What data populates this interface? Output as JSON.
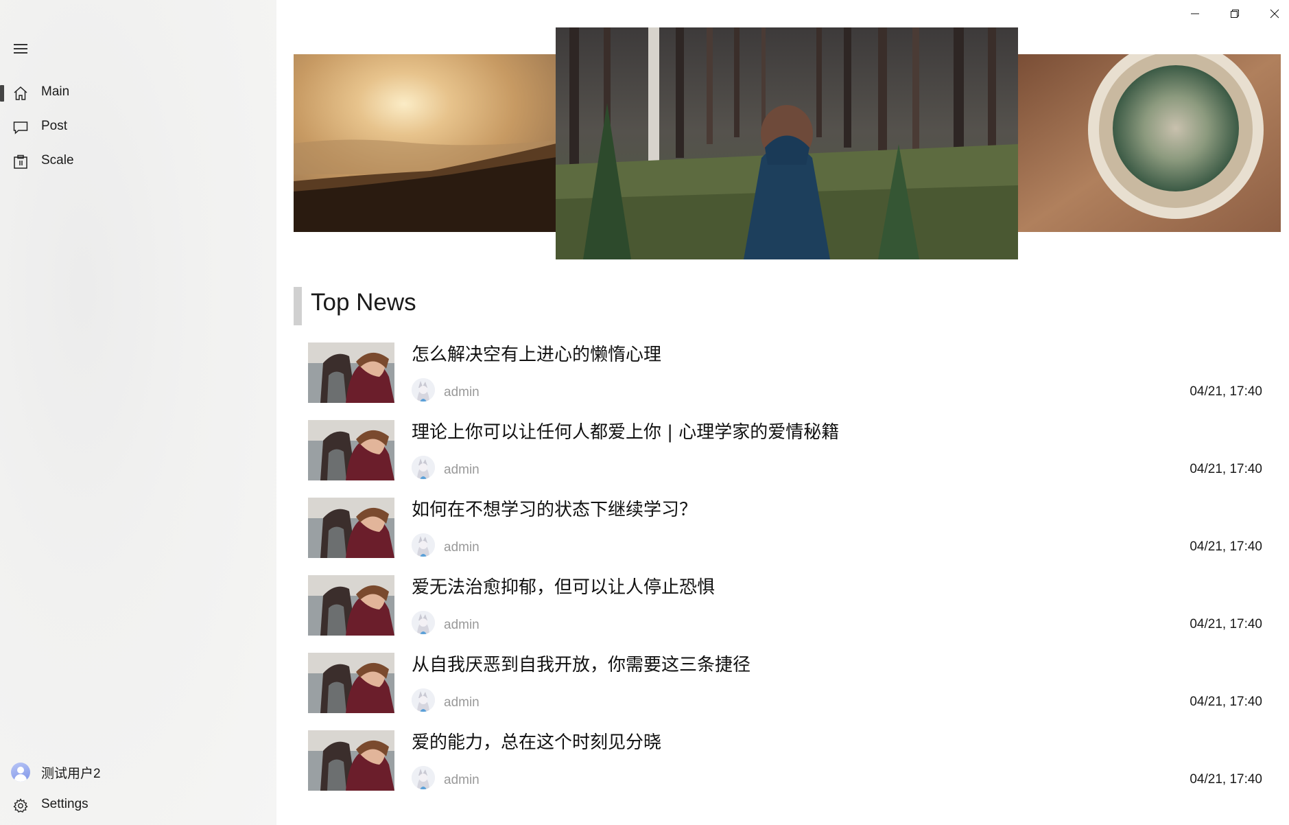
{
  "sidebar": {
    "nav": [
      {
        "label": "Main",
        "icon": "home-icon",
        "selected": true
      },
      {
        "label": "Post",
        "icon": "comment-icon",
        "selected": false
      },
      {
        "label": "Scale",
        "icon": "clipboard-icon",
        "selected": false
      }
    ],
    "user_name": "测试用户2",
    "settings_label": "Settings"
  },
  "window_controls": [
    "minimize-icon",
    "restore-icon",
    "close-icon"
  ],
  "carousel": {
    "slides": [
      "sunset-mountain-photo",
      "forest-woman-photo",
      "cactus-pot-photo"
    ],
    "active_index": 1
  },
  "section": {
    "title": "Top News"
  },
  "news": [
    {
      "title": "怎么解决空有上进心的懒惰心理",
      "author": "admin",
      "time": "04/21, 17:40"
    },
    {
      "title": "理论上你可以让任何人都爱上你 | 心理学家的爱情秘籍",
      "author": "admin",
      "time": "04/21, 17:40"
    },
    {
      "title": "如何在不想学习的状态下继续学习？",
      "author": "admin",
      "time": "04/21, 17:40"
    },
    {
      "title": "爱无法治愈抑郁，但可以让人停止恐惧",
      "author": "admin",
      "time": "04/21, 17:40"
    },
    {
      "title": "从自我厌恶到自我开放，你需要这三条捷径",
      "author": "admin",
      "time": "04/21, 17:40"
    },
    {
      "title": "爱的能力，总在这个时刻见分晓",
      "author": "admin",
      "time": "04/21, 17:40"
    }
  ],
  "colors": {
    "sidebar_bg": "#f2f2f1",
    "selection_indicator": "#444444",
    "author_text": "#999999",
    "section_accent": "#d0d0d0"
  }
}
